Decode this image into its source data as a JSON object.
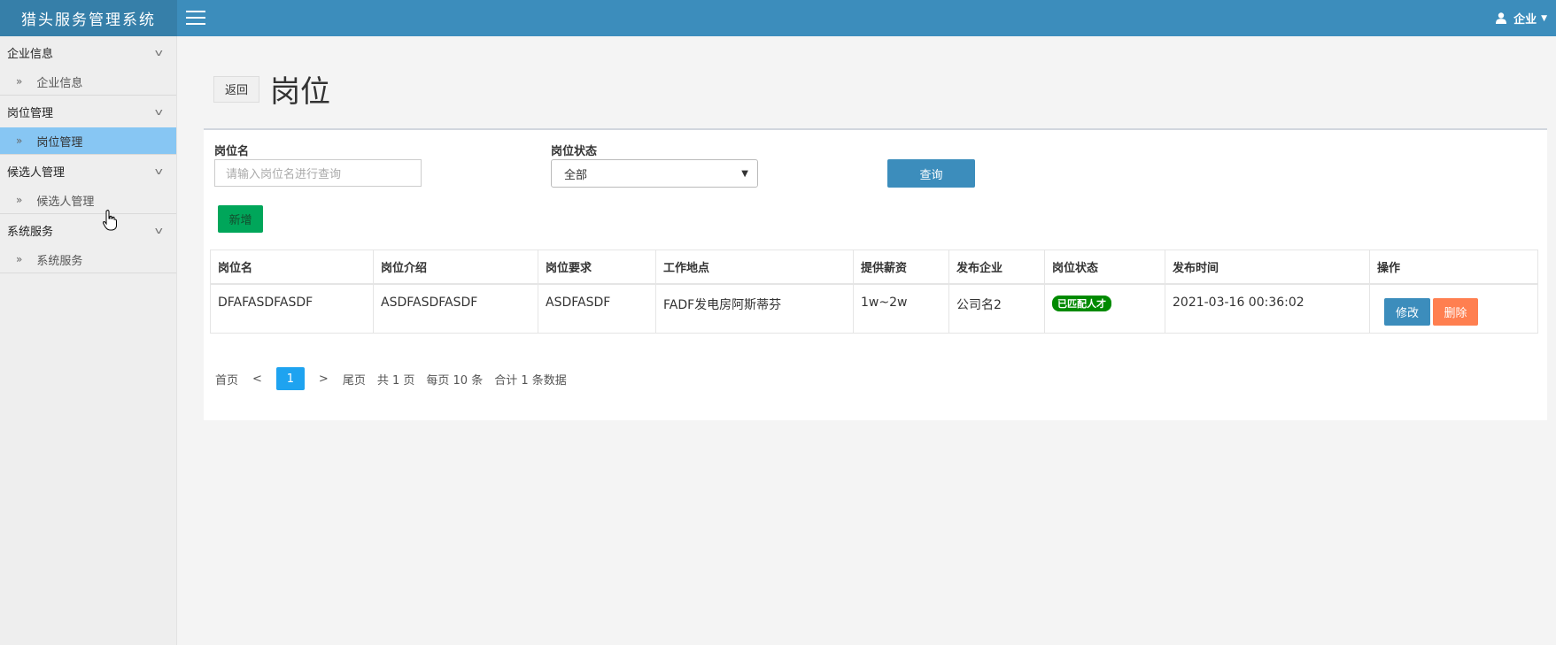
{
  "app": {
    "title": "猎头服务管理系统"
  },
  "header": {
    "user_label": "企业"
  },
  "sidebar": {
    "groups": [
      {
        "title": "企业信息",
        "items": [
          {
            "label": "企业信息",
            "active": false
          }
        ]
      },
      {
        "title": "岗位管理",
        "items": [
          {
            "label": "岗位管理",
            "active": true
          }
        ]
      },
      {
        "title": "候选人管理",
        "items": [
          {
            "label": "候选人管理",
            "active": false
          }
        ]
      },
      {
        "title": "系统服务",
        "items": [
          {
            "label": "系统服务",
            "active": false
          }
        ]
      }
    ]
  },
  "page": {
    "back_label": "返回",
    "title": "岗位"
  },
  "filters": {
    "name_label": "岗位名",
    "name_placeholder": "请输入岗位名进行查询",
    "status_label": "岗位状态",
    "status_value": "全部",
    "query_label": "查询",
    "add_label": "新增"
  },
  "table": {
    "headers": [
      "岗位名",
      "岗位介绍",
      "岗位要求",
      "工作地点",
      "提供薪资",
      "发布企业",
      "岗位状态",
      "发布时间",
      "操作"
    ],
    "rows": [
      {
        "name": "DFAFASDFASDF",
        "intro": "ASDFASDFASDF",
        "requirement": "ASDFASDF",
        "location": "FADF发电房阿斯蒂芬",
        "salary": "1w~2w",
        "company": "公司名2",
        "status": "已匹配人才",
        "time": "2021-03-16 00:36:02",
        "edit_label": "修改",
        "delete_label": "删除"
      }
    ]
  },
  "pagination": {
    "first": "首页",
    "prev": "<",
    "current": "1",
    "next": ">",
    "last": "尾页",
    "total_pages": "共 1 页",
    "per_page": "每页 10 条",
    "total_records": "合计 1 条数据"
  },
  "colors": {
    "header": "#3c8dbc",
    "brand": "#367fa9",
    "active_item": "#87c6f3",
    "status_badge": "#008a00",
    "delete": "#ff7f50",
    "add": "#00a65a"
  }
}
